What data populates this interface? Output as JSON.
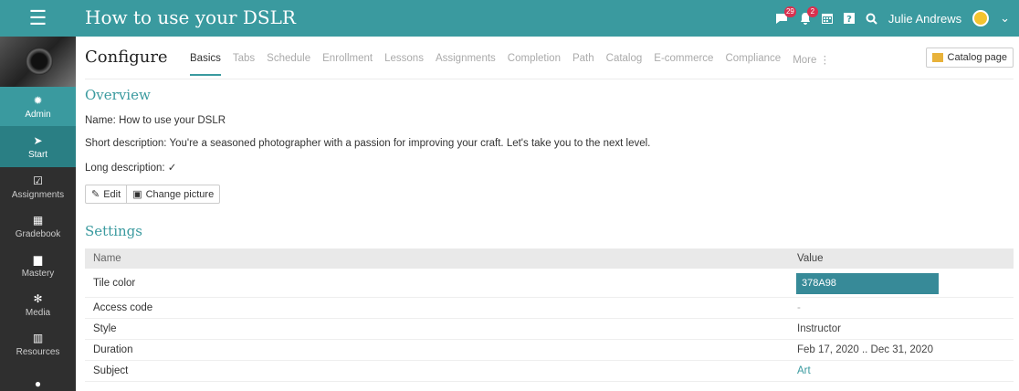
{
  "header": {
    "title": "How to use your DSLR",
    "notifications_badge": "29",
    "alerts_badge": "2",
    "user_name": "Julie Andrews"
  },
  "sidebar": {
    "items": [
      {
        "label": "Admin",
        "icon": "gear-icon"
      },
      {
        "label": "Start",
        "icon": "send-icon"
      },
      {
        "label": "Assignments",
        "icon": "checkbox-icon"
      },
      {
        "label": "Gradebook",
        "icon": "gradebook-icon"
      },
      {
        "label": "Mastery",
        "icon": "bar-chart-icon"
      },
      {
        "label": "Media",
        "icon": "media-icon"
      },
      {
        "label": "Resources",
        "icon": "resources-icon"
      },
      {
        "label": "",
        "icon": "person-icon"
      }
    ]
  },
  "configure": {
    "title": "Configure",
    "tabs": [
      "Basics",
      "Tabs",
      "Schedule",
      "Enrollment",
      "Lessons",
      "Assignments",
      "Completion",
      "Path",
      "Catalog",
      "E-commerce",
      "Compliance",
      "More"
    ],
    "catalog_page_label": "Catalog page"
  },
  "overview": {
    "heading": "Overview",
    "name_line": "Name: How to use your DSLR",
    "short_desc_line": "Short description: You're a seasoned photographer with a passion for improving your craft. Let's take you to the next level.",
    "long_desc_line": "Long description: ✓",
    "edit_label": "Edit",
    "change_picture_label": "Change picture"
  },
  "settings": {
    "heading": "Settings",
    "col_name": "Name",
    "col_value": "Value",
    "rows": [
      {
        "name": "Tile color",
        "value": "378A98"
      },
      {
        "name": "Access code",
        "value": "-"
      },
      {
        "name": "Style",
        "value": "Instructor"
      },
      {
        "name": "Duration",
        "value": "Feb 17, 2020 .. Dec 31, 2020"
      },
      {
        "name": "Subject",
        "value": "Art"
      }
    ]
  },
  "colors": {
    "accent": "#3a9a9f",
    "tile": "#378a98",
    "sidebar": "#2f2f2f"
  }
}
